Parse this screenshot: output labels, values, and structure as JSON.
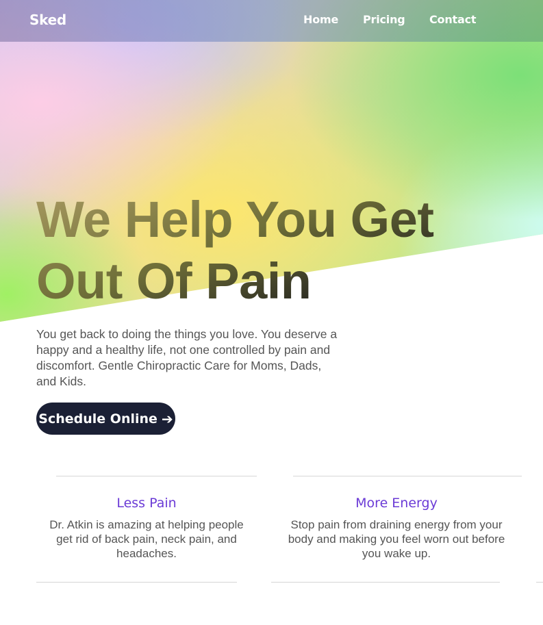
{
  "nav": {
    "logo": "Sked",
    "links": [
      {
        "label": "Home"
      },
      {
        "label": "Pricing"
      },
      {
        "label": "Contact"
      }
    ]
  },
  "hero": {
    "headline_line1": "We Help You Get",
    "headline_line2": "Out Of Pain",
    "subtext": "You get back to doing the things you love. You deserve a happy and a healthy life, not one controlled by pain and discomfort. Gentle Chiropractic Care for Moms, Dads, and Kids.",
    "cta_label": "Schedule Online",
    "cta_icon": "arrow-right-icon"
  },
  "features": [
    {
      "title": "Less Pain",
      "text": "Dr. Atkin is amazing at helping people get rid of back pain, neck pain, and headaches."
    },
    {
      "title": "More Energy",
      "text": "Stop pain from draining energy from your body and making you feel worn out before you wake up."
    }
  ],
  "colors": {
    "accent": "#6b3bd6",
    "button_bg": "#1b2035",
    "body_text": "#555555",
    "divider": "#d6d6d6"
  }
}
